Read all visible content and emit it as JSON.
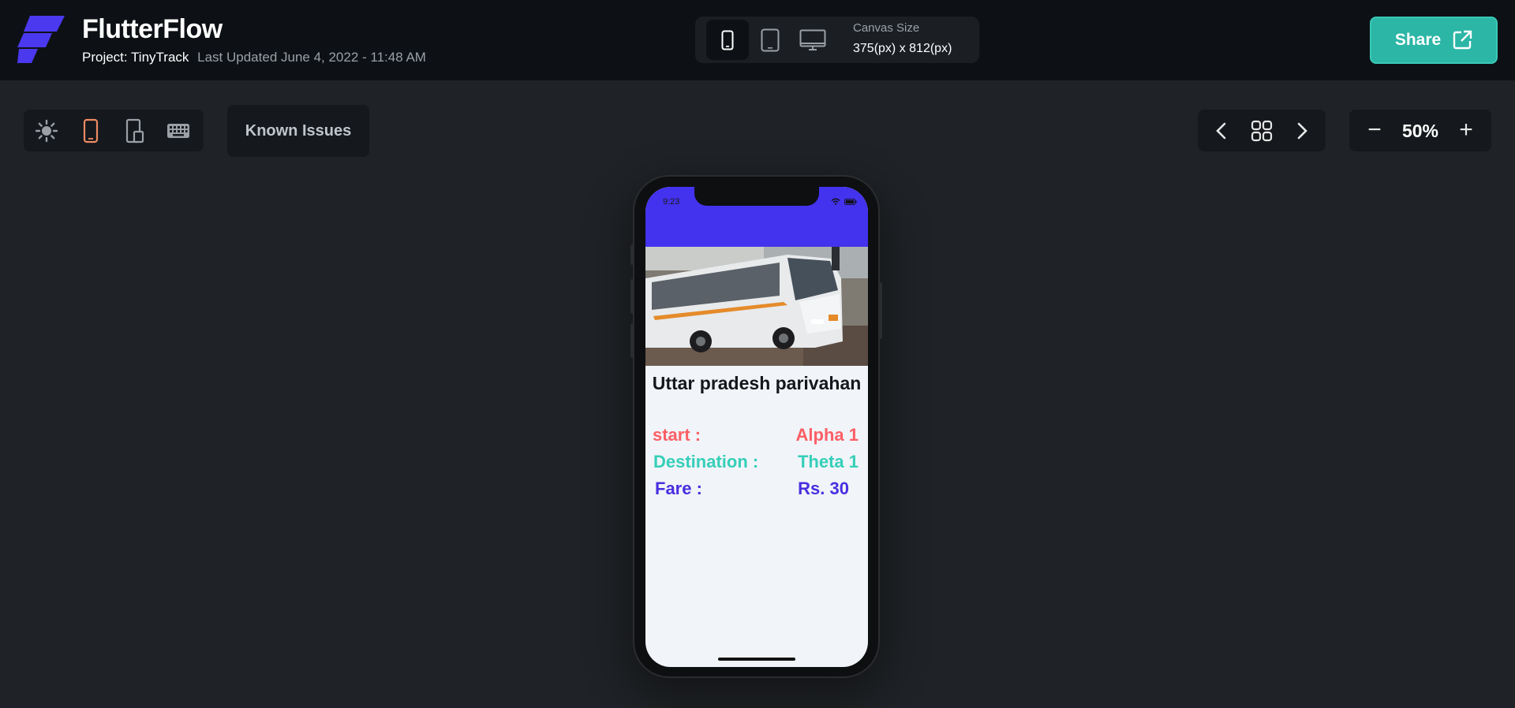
{
  "header": {
    "brand": "FlutterFlow",
    "project": "Project: TinyTrack",
    "last_updated": "Last Updated June 4, 2022 - 11:48 AM",
    "canvas_label": "Canvas Size",
    "canvas_value": "375(px) x 812(px)",
    "share_label": "Share",
    "device_options": [
      "phone-icon",
      "tablet-icon",
      "desktop-icon"
    ],
    "selected_device": "phone"
  },
  "toolbar": {
    "known_issues_label": "Known Issues",
    "zoom_value": "50%",
    "zoom_minus": "−",
    "zoom_plus": "+",
    "tools": [
      "sun-icon",
      "phone-portrait-icon",
      "responsive-icon",
      "keyboard-icon"
    ]
  },
  "app": {
    "status_time": "9:23",
    "title": "Uttar pradesh parivahan",
    "rows": [
      {
        "label": "start :",
        "value": "Alpha 1",
        "color": "#fc5f66"
      },
      {
        "label": "Destination :",
        "value": "Theta 1",
        "color": "#35cfb9"
      },
      {
        "label": "Fare :",
        "value": "Rs. 30",
        "color": "#4a2ee0"
      }
    ],
    "appbar_color": "#4332ee"
  },
  "colors": {
    "background": "#1f2226",
    "header": "#0d1115",
    "accent": "#2bb6a6",
    "active_tool": "#ee8a63"
  }
}
